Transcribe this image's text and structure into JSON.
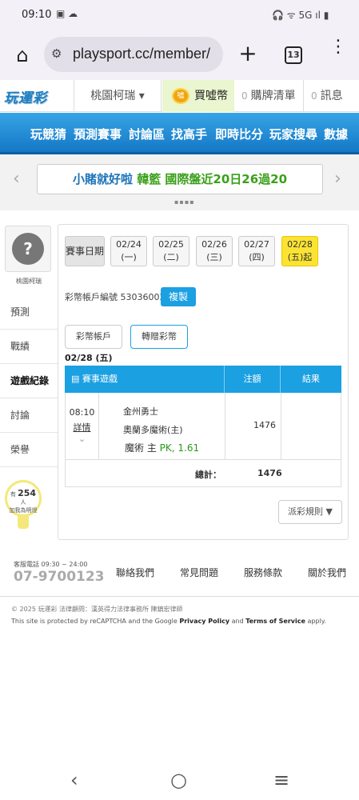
{
  "status": {
    "time": "09:10",
    "icons_left": "▣ ☁",
    "icons_right": "🎧 ᯤ 5G ıl ▮"
  },
  "browser": {
    "url": "playsport.cc/member/",
    "tab_count": "13",
    "home_icon": "⌂",
    "plus": "+",
    "menu": "⋮",
    "tune_icon": "⚙"
  },
  "topnav": {
    "logo": "玩運彩",
    "user": "桃園柯瑞 ▾",
    "buy": "買噓幣",
    "coin_label": "噓",
    "list_count": "0",
    "list": "購牌清單",
    "msg_count": "0",
    "msg": "訊息"
  },
  "mainnav": [
    "玩競猜",
    "預測賽事",
    "討論區",
    "找高手",
    "即時比分",
    "玩家搜尋",
    "數據"
  ],
  "marquee": {
    "text_a": "小賭就好啦",
    "text_b": "韓籃 國際盤近20日26過20",
    "prev": "‹",
    "next": "›",
    "dots": "▪▪▪▪"
  },
  "sidebar": {
    "username": "桃園柯瑞",
    "avatar_glyph": "?",
    "items": [
      "預測",
      "戰績",
      "遊戲紀錄",
      "討論",
      "榮譽"
    ],
    "active": "遊戲紀錄",
    "bulb_prefix": "有",
    "bulb_count": "254",
    "bulb_suffix": "人",
    "bulb_text": "加我為明燈"
  },
  "dates": {
    "label": "賽事日期",
    "items": [
      {
        "d": "02/24",
        "w": "(一)"
      },
      {
        "d": "02/25",
        "w": "(二)"
      },
      {
        "d": "02/26",
        "w": "(三)"
      },
      {
        "d": "02/27",
        "w": "(四)"
      },
      {
        "d": "02/28",
        "w": "(五)起"
      }
    ]
  },
  "account": {
    "text": "彩幣帳戶編號 53036002",
    "copy": "複製",
    "tab1": "彩幣帳戶",
    "tab2": "轉贈彩幣",
    "date": "02/28 (五)"
  },
  "table": {
    "h1": "賽事遊戲",
    "h2": "注額",
    "h3": "結果",
    "time": "08:10",
    "detail": "詳情",
    "chevron": "⌄",
    "team1": "金州勇士",
    "team2": "奧蘭多魔術(主)",
    "pick": "魔術 主",
    "pick_extra": "PK, 1.61",
    "amount": "1476",
    "total_label": "總計：",
    "total": "1476"
  },
  "rules": "派彩規則 ▼",
  "footer": {
    "svc": "客服電話 09:30 ~ 24:00",
    "phone": "07-9700123",
    "links": [
      "聯絡我們",
      "常見問題",
      "服務條款",
      "關於我們"
    ]
  },
  "copyright": "© 2025 玩運彩 法律顧問：漢英得力法律事務所 陳鎮宏律師",
  "recaptcha": {
    "a": "This site is protected by reCAPTCHA and the Google ",
    "b": "Privacy Policy",
    "c": " and ",
    "d": "Terms of Service",
    "e": " apply."
  },
  "androidnav": {
    "back": "‹",
    "home": "○",
    "recent": "≡"
  }
}
